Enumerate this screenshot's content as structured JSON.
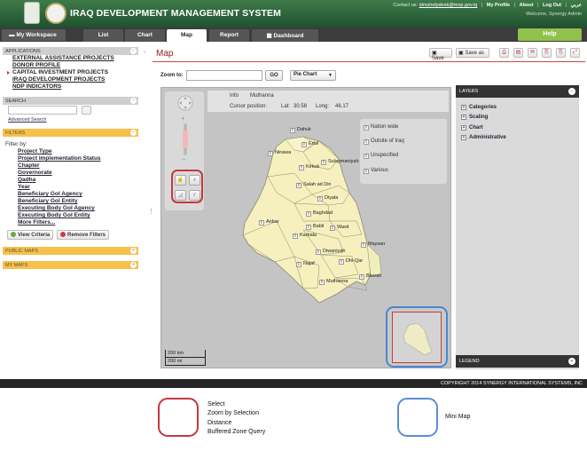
{
  "header": {
    "title": "IRAQ DEVELOPMENT MANAGEMENT SYSTEM",
    "contact_label": "Contact us:",
    "contact_email": "idmshelpdesk@mop.gov.iq",
    "links": [
      "My Profile",
      "About",
      "Log Out"
    ],
    "language": "عربي",
    "welcome": "Welcome, Synergy Admin"
  },
  "nav": {
    "workspace": "My Workspace",
    "tabs": [
      "List",
      "Chart",
      "Map",
      "Report",
      "Dashboard"
    ],
    "active_tab": "Map",
    "help": "Help"
  },
  "sidebar": {
    "applications_header": "APPLICATIONS",
    "applications": [
      "EXTERNAL ASSISTANCE PROJECTS",
      "DONOR PROFILE",
      "CAPITAL INVESTMENT PROJECTS",
      "IRAQ DEVELOPMENT PROJECTS",
      "NDP INDICATORS"
    ],
    "current_application": "CAPITAL INVESTMENT PROJECTS",
    "search_header": "SEARCH",
    "advanced_search": "Advanced Search",
    "filters_header": "FILTERS",
    "filter_by": "Filter by:",
    "filters": [
      "Project Type",
      "Project Implementation Status",
      "Chapter",
      "Governorate",
      "Qadha",
      "Year",
      "Beneficiary GoI Agency",
      "Beneficiary GoI Entity",
      "Executing Body GoI Agency",
      "Executing Body GoI Entity",
      "More Filters..."
    ],
    "view_criteria": "View Criteria",
    "remove_filters": "Remove Filters",
    "public_maps": "PUBLIC MAPS",
    "my_maps": "MY MAPS"
  },
  "main": {
    "title": "Map",
    "toolbar": {
      "save": "Save",
      "save_as": "Save as"
    },
    "zoom_label": "Zoom to:",
    "zoom_value": "",
    "go": "GO",
    "chart_type": "Pie Chart"
  },
  "map": {
    "info_label": "Info",
    "info_value": "Muthanna",
    "cursor_label": "Cursor position:",
    "lat_label": "Lat:",
    "lat": "30.58",
    "long_label": "Long:",
    "long": "46.17",
    "legend_items": [
      "Nation wide",
      "Outsite of Iraq",
      "Unspecified",
      "Various"
    ],
    "governorates": [
      "Dahuk",
      "Erbil",
      "Ninawa",
      "Kirkuk",
      "Sulaymaniyah",
      "Salah ad Din",
      "Diyala",
      "Baghdad",
      "Anbar",
      "Wasit",
      "Babil",
      "Karbala",
      "Maysan",
      "Diwaniyah",
      "Dhi-Qar",
      "Najaf",
      "Basrah",
      "Muthanna"
    ],
    "scale_km": "200 km",
    "scale_mi": "200 mi"
  },
  "right_panel": {
    "layers_header": "LAYERS",
    "layers": [
      "Categories",
      "Scaling",
      "Chart",
      "Administrative"
    ],
    "legend_header": "LEGEND"
  },
  "footer": "COPYRIGHT 2014 SYNERGY INTERNATIONAL SYSTEMS, INC",
  "annotations": {
    "tools": [
      "Select",
      "Zoom by Selection",
      "Distance",
      "Buffered Zone Query"
    ],
    "minimap": "Mini Map",
    "colors": {
      "tools_outline": "#c0393e",
      "minimap_outline": "#5b8ed6"
    }
  }
}
